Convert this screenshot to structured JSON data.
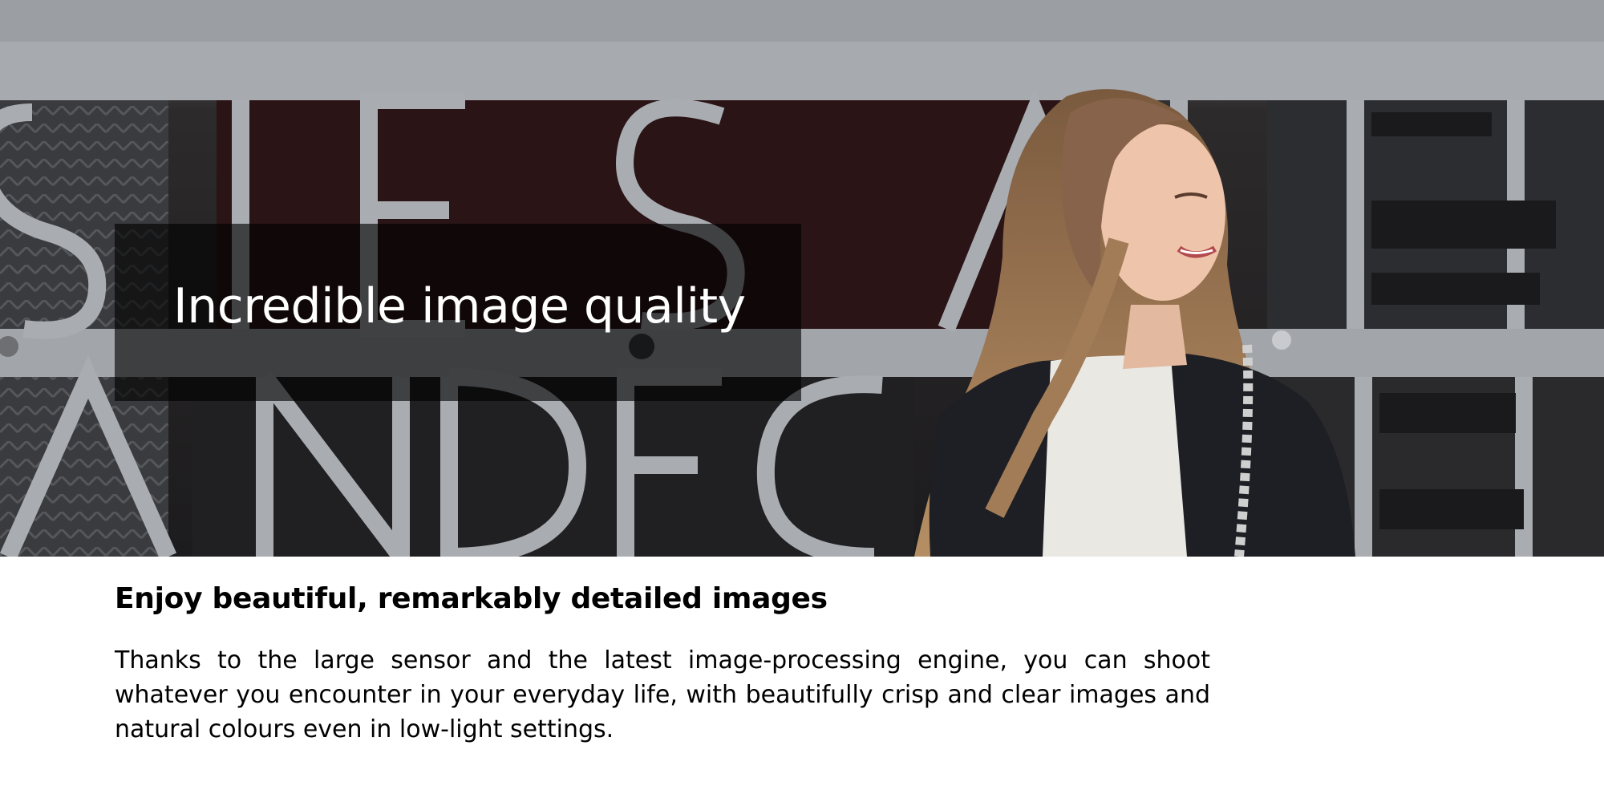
{
  "hero": {
    "image_alt": "Smiling woman with long hair standing in front of a metal lettering facade",
    "headline": "Incredible image quality"
  },
  "feature": {
    "subheading": "Enjoy beautiful, remarkably detailed images",
    "body": "Thanks to the large sensor and the latest image-processing engine, you can shoot whatever you encounter in your everyday life, with beautifully crisp and clear images and natural colours even in low-light settings."
  },
  "colors": {
    "headline_text": "#ffffff",
    "overlay": "rgba(0,0,0,0.62)",
    "body_text": "#000000",
    "background": "#ffffff"
  }
}
